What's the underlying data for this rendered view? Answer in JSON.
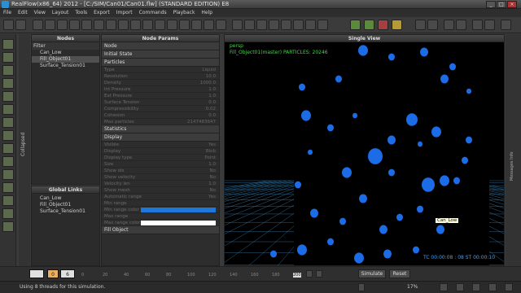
{
  "window": {
    "title": "RealFlow(x86_64) 2012 - [C:/SIM/Can01/Can01.flw] (STANDARD EDITION) E8",
    "buttons": [
      "_",
      "□",
      "×"
    ]
  },
  "menu": [
    "File",
    "Edit",
    "View",
    "Layout",
    "Tools",
    "Export",
    "Import",
    "Commands",
    "Playback",
    "Help"
  ],
  "panels": {
    "collapsed_label": "Collapsed",
    "nodes": {
      "header": "Nodes",
      "filter_label": "Filter",
      "items": [
        "Can_Low",
        "Fill_Object01",
        "Surface_Tension01"
      ]
    },
    "global_links": {
      "header": "Global Links",
      "items": [
        "Can_Low",
        "Fill_Object01",
        "Surface_Tension01"
      ]
    },
    "node_params": {
      "header": "Node Params",
      "sections": [
        {
          "title": "Node",
          "rows": []
        },
        {
          "title": "Initial State",
          "rows": []
        },
        {
          "title": "Particles",
          "rows": [
            {
              "label": "Type",
              "value": "Liquid"
            },
            {
              "label": "Resolution",
              "value": "10.0"
            },
            {
              "label": "Density",
              "value": "1000.0"
            },
            {
              "label": "Int Pressure",
              "value": "1.0"
            },
            {
              "label": "Ext Pressure",
              "value": "1.0"
            },
            {
              "label": "Surface Tension",
              "value": "0.0"
            },
            {
              "label": "Compressibility",
              "value": "0.02"
            },
            {
              "label": "Cohesion",
              "value": "0.0"
            },
            {
              "label": "Max particles",
              "value": "2147483647"
            }
          ]
        },
        {
          "title": "Statistics",
          "rows": []
        },
        {
          "title": "Display",
          "rows": [
            {
              "label": "Visible",
              "value": "Yes"
            },
            {
              "label": "Display",
              "value": "Blob"
            },
            {
              "label": "Display type",
              "value": "Point"
            },
            {
              "label": "Size",
              "value": "1.0"
            },
            {
              "label": "Show ids",
              "value": "No"
            },
            {
              "label": "Show velocity",
              "value": "No"
            },
            {
              "label": "Velocity len",
              "value": "1.0"
            },
            {
              "label": "Show mesh",
              "value": "No"
            },
            {
              "label": "Automatic range",
              "value": "Yes"
            },
            {
              "label": "Min range",
              "value": ""
            },
            {
              "label": "Min range color",
              "value": "",
              "color": "#1e78dc"
            },
            {
              "label": "Max range",
              "value": ""
            },
            {
              "label": "Max range color",
              "value": "",
              "color": "#ffffff"
            }
          ]
        },
        {
          "title": "Fill Object",
          "rows": []
        }
      ]
    }
  },
  "viewport": {
    "header": "Single View",
    "camera": "persp",
    "info": "Fill_Object01(master) PARTICLES: 20246",
    "timecode": "TC 00:00:08 : 08   ST 00:00:10",
    "tooltip": "Can_Low",
    "right_label": "Messages Info"
  },
  "timeline": {
    "current_frame": "0",
    "end_frame": "6",
    "ticks": [
      "0",
      "20",
      "40",
      "60",
      "80",
      "100",
      "120",
      "140",
      "160",
      "180",
      "200"
    ],
    "mode": "Simulate",
    "reset": "Reset"
  },
  "status": {
    "message": "Using 8 threads for this simulation.",
    "zoom": "17%"
  },
  "colors": {
    "accent": "#2c8fd4",
    "particle": "#1e78ff",
    "hud_green": "#3ddc3d",
    "grid": "#3a7fae"
  }
}
